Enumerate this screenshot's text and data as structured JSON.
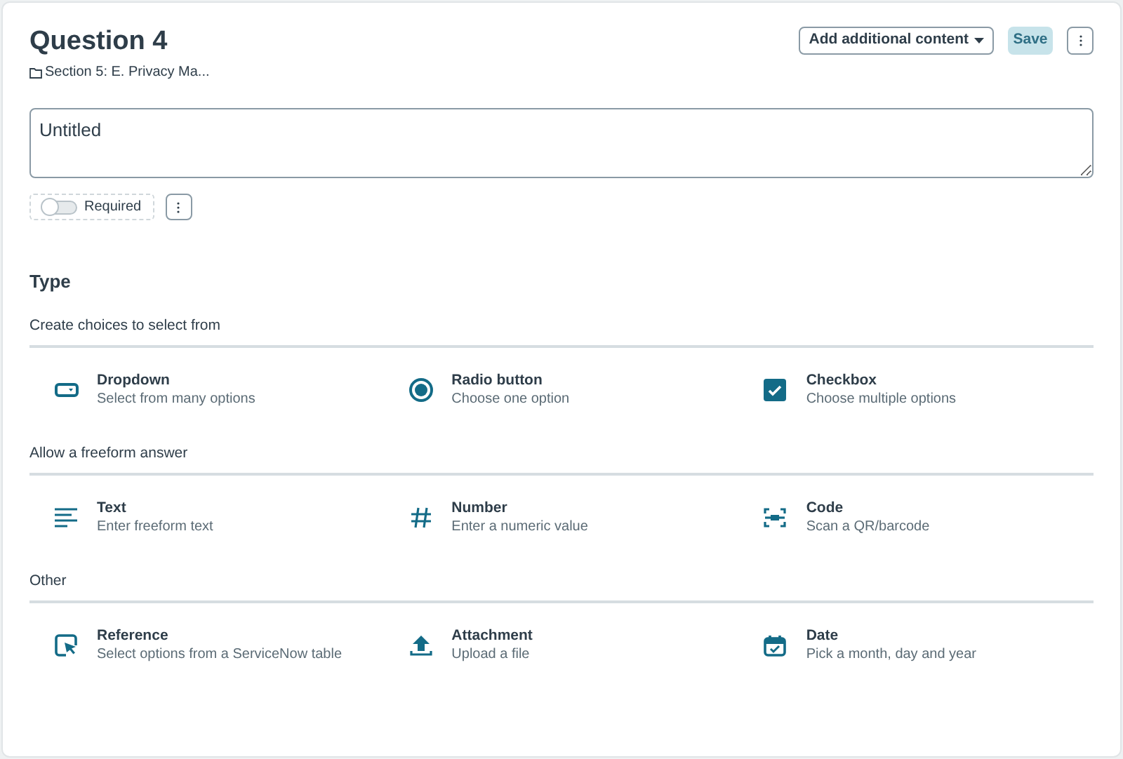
{
  "title": "Question 4",
  "section": "Section 5: E. Privacy Ma...",
  "add_content_button": "Add additional content",
  "save_button": {
    "label": "Save",
    "disabled": true
  },
  "question_field": {
    "value": "Untitled"
  },
  "required_toggle": {
    "label": "Required",
    "on": false
  },
  "type_heading": "Type",
  "groups": [
    {
      "heading": "Create choices to select from",
      "items": [
        {
          "kind": "dropdown",
          "title": "Dropdown",
          "description": "Select from many options"
        },
        {
          "kind": "radio",
          "title": "Radio button",
          "description": "Choose one option"
        },
        {
          "kind": "checkbox",
          "title": "Checkbox",
          "description": "Choose multiple options"
        }
      ]
    },
    {
      "heading": "Allow a freeform answer",
      "items": [
        {
          "kind": "text",
          "title": "Text",
          "description": "Enter freeform text"
        },
        {
          "kind": "number",
          "title": "Number",
          "description": "Enter a numeric value"
        },
        {
          "kind": "code",
          "title": "Code",
          "description": "Scan a QR/barcode"
        }
      ]
    },
    {
      "heading": "Other",
      "items": [
        {
          "kind": "reference",
          "title": "Reference",
          "description": "Select options from a ServiceNow table"
        },
        {
          "kind": "attachment",
          "title": "Attachment",
          "description": "Upload a file"
        },
        {
          "kind": "date",
          "title": "Date",
          "description": "Pick a month, day and year"
        }
      ]
    }
  ]
}
